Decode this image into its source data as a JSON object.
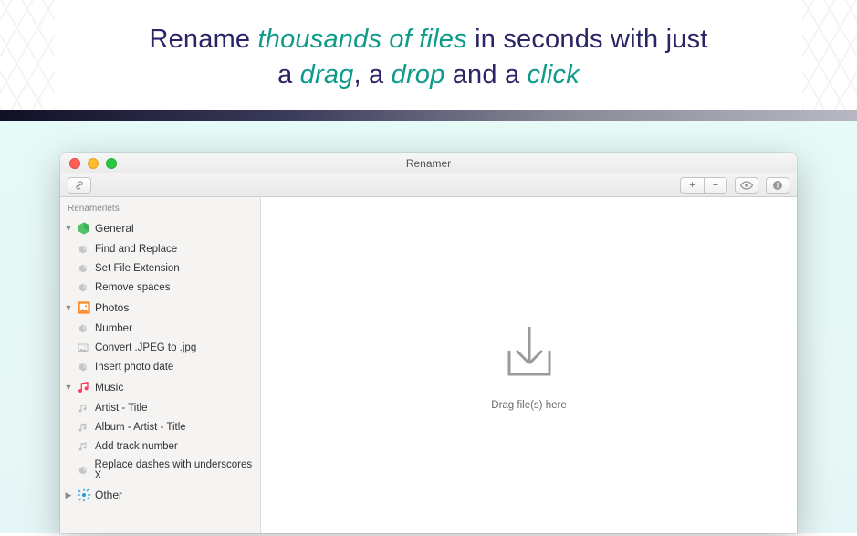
{
  "hero": {
    "t1": "Rename ",
    "e1": "thousands of files",
    "t2": " in seconds with just",
    "t3": "a ",
    "e2": "drag",
    "t4": ", a ",
    "e3": "drop",
    "t5": " and a ",
    "e4": "click"
  },
  "window": {
    "title": "Renamer"
  },
  "toolbar": {
    "link_label": "🔗",
    "plus": "+",
    "minus": "−",
    "eye": "👁",
    "info": "i"
  },
  "sidebar": {
    "header": "Renamerlets",
    "groups": [
      {
        "id": "general",
        "label": "General",
        "open": true,
        "items": [
          {
            "label": "Find and Replace",
            "icon": "action-icon"
          },
          {
            "label": "Set File Extension",
            "icon": "action-icon"
          },
          {
            "label": "Remove spaces",
            "icon": "action-icon"
          }
        ]
      },
      {
        "id": "photos",
        "label": "Photos",
        "open": true,
        "items": [
          {
            "label": "Number",
            "icon": "action-icon"
          },
          {
            "label": "Convert .JPEG to .jpg",
            "icon": "photo-icon"
          },
          {
            "label": "Insert photo date",
            "icon": "action-icon"
          }
        ]
      },
      {
        "id": "music",
        "label": "Music",
        "open": true,
        "items": [
          {
            "label": "Artist - Title",
            "icon": "music-icon"
          },
          {
            "label": "Album - Artist - Title",
            "icon": "music-icon"
          },
          {
            "label": "Add track number",
            "icon": "music-icon"
          },
          {
            "label": "Replace dashes with underscores X",
            "icon": "action-icon"
          }
        ]
      },
      {
        "id": "other",
        "label": "Other",
        "open": false,
        "items": []
      }
    ]
  },
  "main": {
    "drop_text": "Drag file(s) here"
  }
}
